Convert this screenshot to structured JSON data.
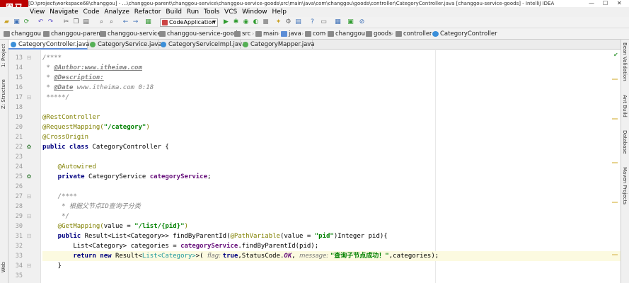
{
  "window": {
    "logo_text": "黑马",
    "title": "[D:\\project\\workspace68\\changgou] - ...\\changgou-parent\\changgou-service\\changgou-service-goods\\src\\main\\java\\com\\changgou\\goods\\controller\\CategoryController.java [changgou-service-goods] - IntelliJ IDEA",
    "minimize": "—",
    "maximize": "☐",
    "close": "✕"
  },
  "menu": [
    "View",
    "Navigate",
    "Code",
    "Analyze",
    "Refactor",
    "Build",
    "Run",
    "Tools",
    "VCS",
    "Window",
    "Help"
  ],
  "toolbar": {
    "run_config": "CodeApplication"
  },
  "breadcrumb": [
    "changgou",
    "changgou-parent",
    "changgou-service",
    "changgou-service-goods",
    "src",
    "main",
    "java",
    "com",
    "changgou",
    "goods",
    "controller",
    "CategoryController"
  ],
  "left_tools": [
    "1: Project",
    "Z: Structure",
    "Web"
  ],
  "right_tools": [
    "Bean Validation",
    "Ant Build",
    "Database",
    "Maven Projects"
  ],
  "tabs": [
    {
      "label": "CategoryController.java",
      "active": true
    },
    {
      "label": "CategoryService.java",
      "active": false
    },
    {
      "label": "CategoryServiceImpl.java",
      "active": false
    },
    {
      "label": "CategoryMapper.java",
      "active": false
    }
  ],
  "line_numbers": [
    "13",
    "14",
    "15",
    "16",
    "17",
    "18",
    "19",
    "20",
    "21",
    "22",
    "23",
    "24",
    "25",
    "26",
    "27",
    "28",
    "29",
    "30",
    "31",
    "32",
    "33",
    "34",
    "35"
  ],
  "code": {
    "l13": "/****",
    "l14_star": " * ",
    "l14_tag": "@Author:www.itheima.com",
    "l15_star": " * ",
    "l15_tag": "@Description:",
    "l16_star": " * ",
    "l16_tag": "@Date",
    "l16_rest": " www.itheima.com 0:18",
    "l17": " *****/",
    "l19": "@RestController",
    "l20_an": "@RequestMapping(",
    "l20_str": "\"/category\"",
    "l20_end": ")",
    "l21": "@CrossOrigin",
    "l22_kw": "public class",
    "l22_rest": " CategoryController {",
    "l24": "    @Autowired",
    "l25_kw": "    private",
    "l25_type": " CategoryService ",
    "l25_field": "categoryService",
    "l25_end": ";",
    "l27": "    /****",
    "l28": "     * 根据父节点ID查询子分类",
    "l29": "     */",
    "l30_an": "    @GetMapping(",
    "l30_mid": "value = ",
    "l30_str": "\"/list/{pid}\"",
    "l30_end": ")",
    "l31_kw": "    public",
    "l31_a": " Result<List<Category>> findByParentId(",
    "l31_an": "@PathVariable",
    "l31_b": "(value = ",
    "l31_str": "\"pid\"",
    "l31_c": ")Integer pid){",
    "l32_a": "        List<Category> categories = ",
    "l32_field": "categoryService",
    "l32_b": ".findByParentId(pid);",
    "l33_kw": "        return new",
    "l33_a": " Result<",
    "l33_gen": "List<Category>",
    "l33_b": ">( ",
    "l33_hint1": "flag: ",
    "l33_true": "true",
    "l33_c": ",StatusCode.",
    "l33_ok": "OK",
    "l33_d": ", ",
    "l33_hint2": "message: ",
    "l33_str": "\"查询子节点成功！\"",
    "l33_e": ",categories);",
    "l34": "    }",
    "l35": ""
  }
}
